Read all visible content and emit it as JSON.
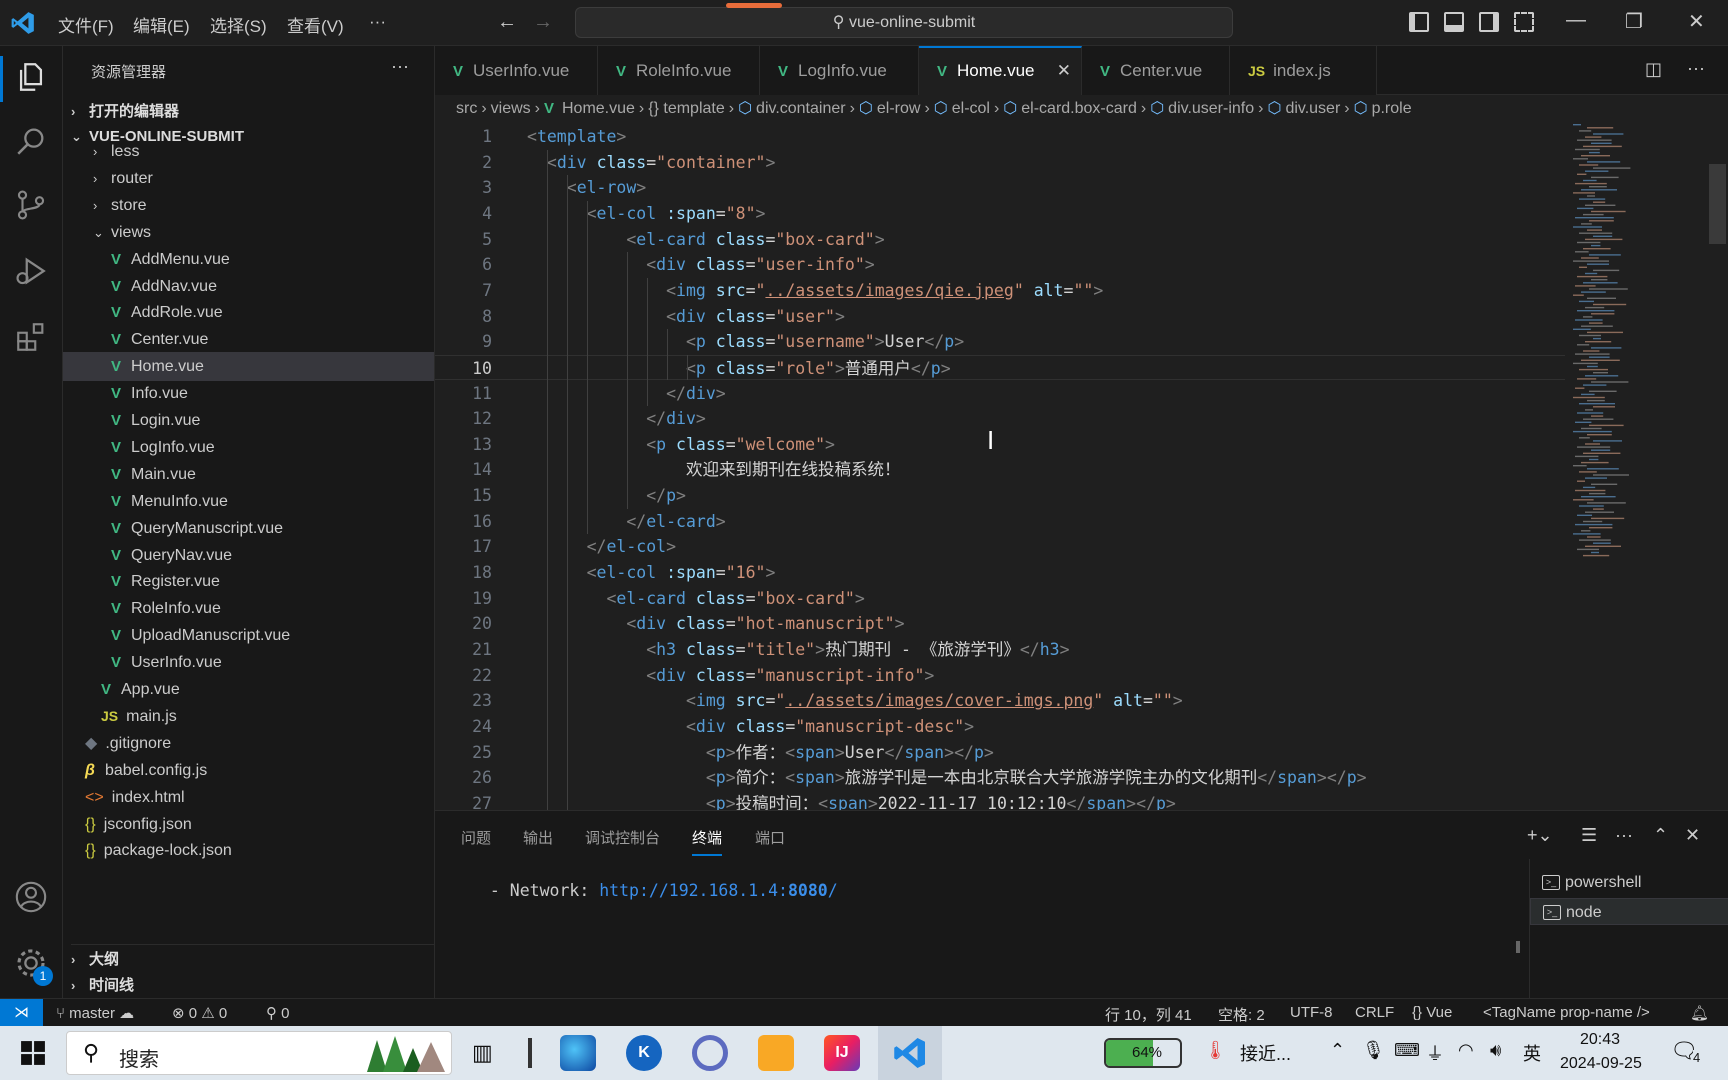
{
  "menu": {
    "file": "文件(F)",
    "edit": "编辑(E)",
    "select": "选择(S)",
    "view": "查看(V)",
    "more": "···"
  },
  "search": {
    "text": "vue-online-submit"
  },
  "sidebar": {
    "title": "资源管理器",
    "more": "···",
    "open_editors": "打开的编辑器",
    "project": "VUE-ONLINE-SUBMIT",
    "folders": [
      "less",
      "router",
      "store",
      "views"
    ],
    "views_files": [
      "AddMenu.vue",
      "AddNav.vue",
      "AddRole.vue",
      "Center.vue",
      "Home.vue",
      "Info.vue",
      "Login.vue",
      "LogInfo.vue",
      "Main.vue",
      "MenuInfo.vue",
      "QueryManuscript.vue",
      "QueryNav.vue",
      "Register.vue",
      "RoleInfo.vue",
      "UploadManuscript.vue",
      "UserInfo.vue"
    ],
    "src_files": [
      "App.vue",
      "main.js"
    ],
    "root_files": [
      ".gitignore",
      "babel.config.js",
      "index.html",
      "jsconfig.json",
      "package-lock.json"
    ],
    "outline": "大纲",
    "timeline": "时间线"
  },
  "tabs": [
    "UserInfo.vue",
    "RoleInfo.vue",
    "LogInfo.vue",
    "Home.vue",
    "Center.vue",
    "index.js"
  ],
  "breadcrumb": [
    "src",
    "views",
    "Home.vue",
    "{} template",
    "div.container",
    "el-row",
    "el-col",
    "el-card.box-card",
    "div.user-info",
    "div.user",
    "p.role"
  ],
  "panel": {
    "tabs": [
      "问题",
      "输出",
      "调试控制台",
      "终端",
      "端口"
    ],
    "terminal_prefix": " - Network: ",
    "terminal_url": "http://192.168.1.4:",
    "terminal_port": "8080",
    "terminal_suffix": "/",
    "terminals": [
      "powershell",
      "node"
    ]
  },
  "status": {
    "branch": "master",
    "errors": "0",
    "warnings": "0",
    "ports": "0",
    "position": "行 10，列 41",
    "spaces": "空格: 2",
    "encoding": "UTF-8",
    "eol": "CRLF",
    "language": "Vue",
    "tagname": "<TagName prop-name />"
  },
  "taskbar": {
    "search": "搜索",
    "battery": "64%",
    "weather": "接近...",
    "ime": "英",
    "time": "20:43",
    "date": "2024-09-25",
    "notifications": "4"
  }
}
